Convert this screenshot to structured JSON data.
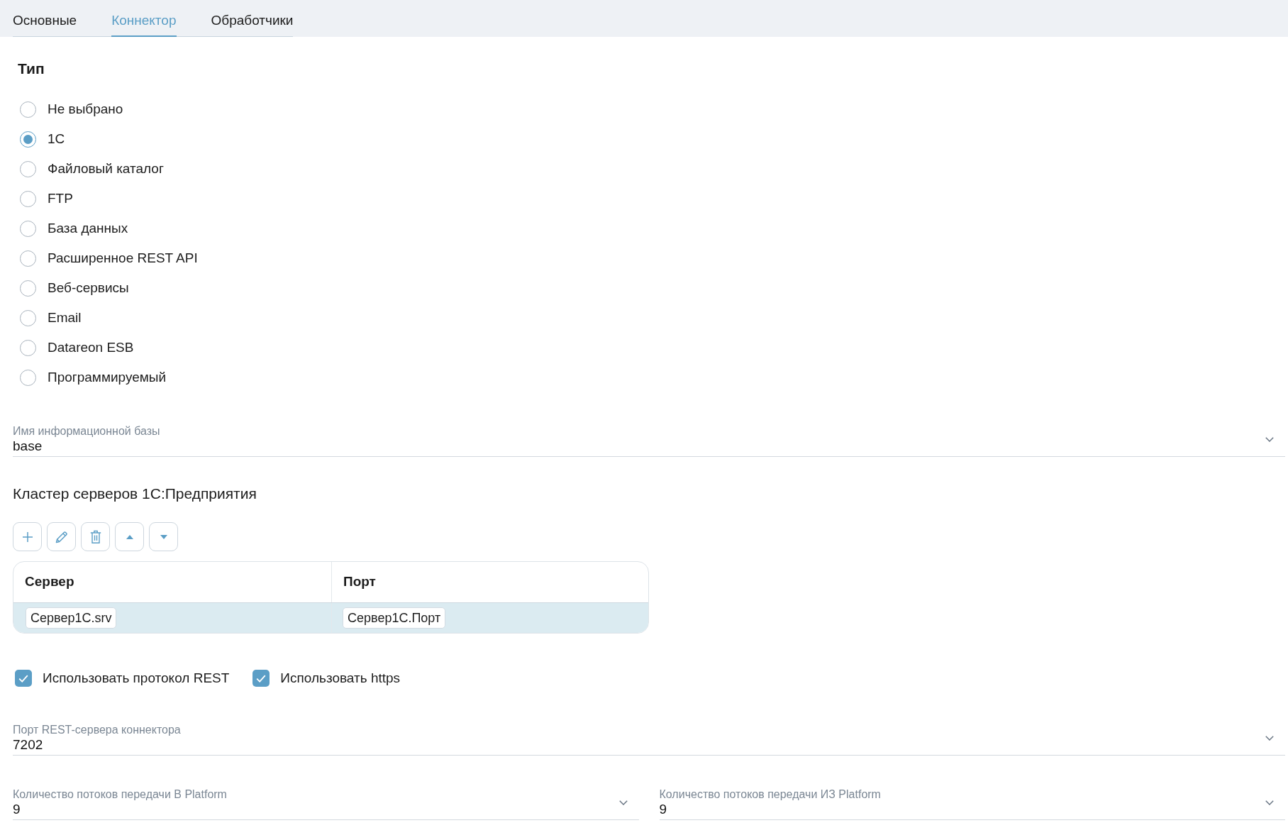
{
  "tabs": [
    {
      "label": "Основные",
      "selected": false
    },
    {
      "label": "Коннектор",
      "selected": true
    },
    {
      "label": "Обработчики",
      "selected": false
    }
  ],
  "connector_type": {
    "title": "Тип",
    "options": [
      {
        "label": "Не выбрано",
        "selected": false
      },
      {
        "label": "1С",
        "selected": true
      },
      {
        "label": "Файловый каталог",
        "selected": false
      },
      {
        "label": "FTP",
        "selected": false
      },
      {
        "label": "База данных",
        "selected": false
      },
      {
        "label": "Расширенное REST API",
        "selected": false
      },
      {
        "label": "Веб-сервисы",
        "selected": false
      },
      {
        "label": "Email",
        "selected": false
      },
      {
        "label": "Datareon ESB",
        "selected": false
      },
      {
        "label": "Программируемый",
        "selected": false
      }
    ]
  },
  "infobase_name": {
    "label": "Имя информационной базы",
    "value": "base"
  },
  "server_cluster": {
    "title": "Кластер серверов 1С:Предприятия",
    "table": {
      "columns": [
        "Сервер",
        "Порт"
      ],
      "rows": [
        {
          "cells": [
            "Сервер1С.srv",
            "Сервер1С.Порт"
          ],
          "selected": true
        }
      ]
    }
  },
  "options": [
    {
      "label": "Использовать протокол REST",
      "checked": true
    },
    {
      "label": "Использовать https",
      "checked": true
    }
  ],
  "rest_port": {
    "label": "Порт REST-сервера коннектора",
    "value": "7202"
  },
  "thread_fields": [
    {
      "label": "Количество потоков передачи В Platform",
      "value": "9"
    },
    {
      "label": "Количество потоков передачи ИЗ Platform",
      "value": "9"
    }
  ]
}
